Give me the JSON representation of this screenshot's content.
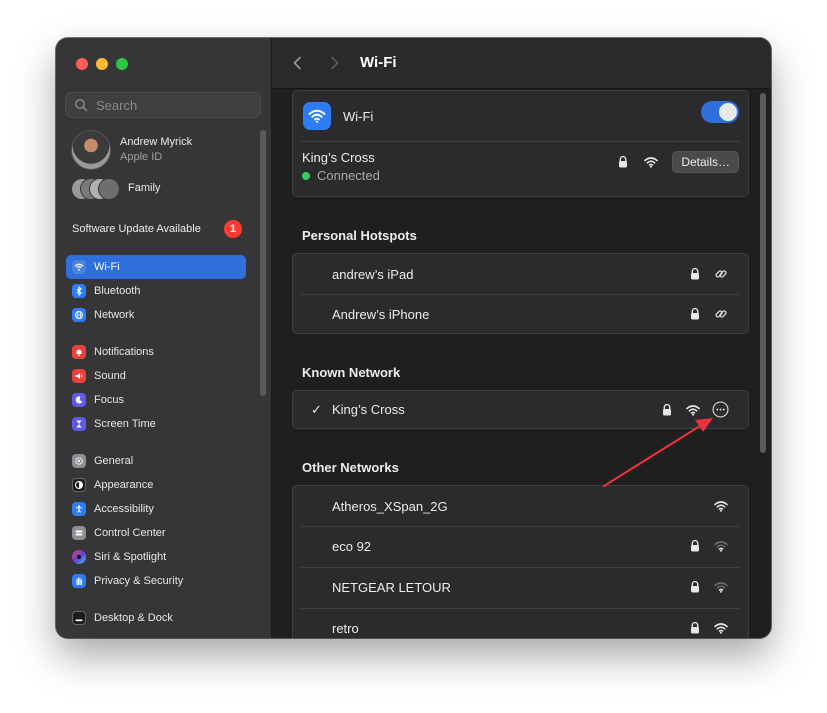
{
  "sidebar": {
    "search_placeholder": "Search",
    "profile": {
      "name": "Andrew Myrick",
      "subtitle": "Apple ID"
    },
    "family_label": "Family",
    "software_update": {
      "label": "Software Update Available",
      "count": "1"
    },
    "groups": [
      [
        {
          "label": "Wi-Fi",
          "icon": "wifi-icon",
          "color": "#2e7cf6",
          "active": true
        },
        {
          "label": "Bluetooth",
          "icon": "bluetooth-icon",
          "color": "#2e7cf6"
        },
        {
          "label": "Network",
          "icon": "globe-icon",
          "color": "#2e7cf6"
        }
      ],
      [
        {
          "label": "Notifications",
          "icon": "bell-icon",
          "color": "#e8433a"
        },
        {
          "label": "Sound",
          "icon": "speaker-icon",
          "color": "#e8433a"
        },
        {
          "label": "Focus",
          "icon": "moon-icon",
          "color": "#5e5ce6"
        },
        {
          "label": "Screen Time",
          "icon": "hourglass-icon",
          "color": "#5e5ce6"
        }
      ],
      [
        {
          "label": "General",
          "icon": "gear-icon",
          "color": "#8e8e93"
        },
        {
          "label": "Appearance",
          "icon": "appearance-icon",
          "color": "#1c1c1e"
        },
        {
          "label": "Accessibility",
          "icon": "accessibility-icon",
          "color": "#2e7cf6"
        },
        {
          "label": "Control Center",
          "icon": "control-center-icon",
          "color": "#8e8e93"
        },
        {
          "label": "Siri & Spotlight",
          "icon": "siri-icon",
          "color": "#6a3fd1"
        },
        {
          "label": "Privacy & Security",
          "icon": "hand-icon",
          "color": "#2e7cf6"
        }
      ],
      [
        {
          "label": "Desktop & Dock",
          "icon": "dock-icon",
          "color": "#1c1c1e"
        }
      ]
    ]
  },
  "main": {
    "title": "Wi-Fi",
    "wifi_label": "Wi-Fi",
    "current": {
      "name": "King’s Cross",
      "status": "Connected",
      "details_label": "Details…"
    },
    "sections": {
      "hotspots": "Personal Hotspots",
      "known": "Known Network",
      "other": "Other Networks"
    },
    "hotspots": [
      {
        "name": "andrew’s iPad"
      },
      {
        "name": "Andrew’s iPhone"
      }
    ],
    "known": [
      {
        "name": "King’s Cross",
        "checked": "✓"
      }
    ],
    "other": [
      {
        "name": "Atheros_XSpan_2G",
        "locked": false,
        "strength": "strong"
      },
      {
        "name": "eco 92",
        "locked": true,
        "strength": "weak"
      },
      {
        "name": "NETGEAR LETOUR",
        "locked": true,
        "strength": "weak"
      },
      {
        "name": "retro",
        "locked": true,
        "strength": "strong"
      }
    ]
  },
  "colors": {
    "accent": "#2e6fdb",
    "connected": "#30d158",
    "badge": "#ff3b30",
    "annotation_arrow": "#e8323c"
  }
}
